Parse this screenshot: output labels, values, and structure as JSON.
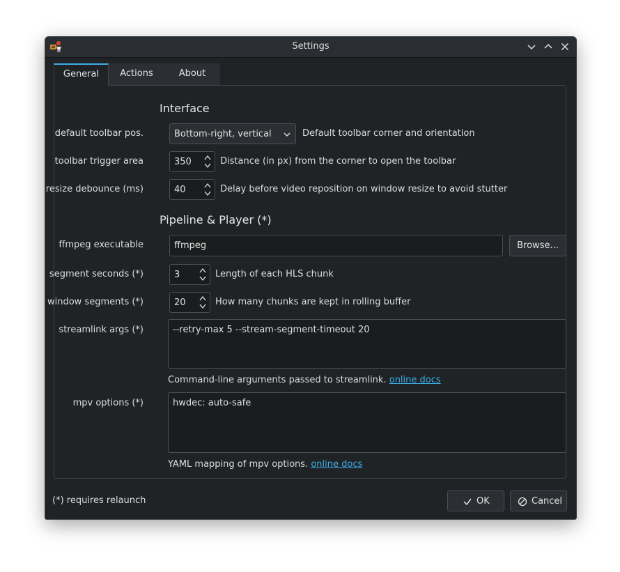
{
  "window": {
    "title": "Settings"
  },
  "tabs": [
    {
      "label": "General"
    },
    {
      "label": "Actions"
    },
    {
      "label": "About"
    }
  ],
  "interface": {
    "title": "Interface",
    "toolbar_pos": {
      "label": "default toolbar pos.",
      "value": "Bottom-right, vertical",
      "description": "Default toolbar corner and orientation"
    },
    "trigger_area": {
      "label": "toolbar trigger area",
      "value": "350",
      "description": "Distance (in px) from the corner to open the toolbar"
    },
    "resize_debounce": {
      "label": "resize debounce (ms)",
      "value": "40",
      "description": "Delay before video reposition on window resize to avoid stutter"
    }
  },
  "pipeline": {
    "title": "Pipeline & Player (*)",
    "ffmpeg": {
      "label": "ffmpeg executable",
      "value": "ffmpeg",
      "browse_label": "Browse..."
    },
    "segment_seconds": {
      "label": "segment seconds (*)",
      "value": "3",
      "description": "Length of each HLS chunk"
    },
    "window_segments": {
      "label": "window segments (*)",
      "value": "20",
      "description": "How many chunks are kept in rolling buffer"
    },
    "streamlink_args": {
      "label": "streamlink args (*)",
      "value": "--retry-max 5 --stream-segment-timeout 20",
      "help": "Command-line arguments passed to streamlink.",
      "link": "online docs"
    },
    "mpv_options": {
      "label": "mpv options (*)",
      "value": "hwdec: auto-safe",
      "help": "YAML mapping of mpv options.",
      "link": "online docs"
    }
  },
  "footer": {
    "note": "(*) requires relaunch",
    "ok_label": "OK",
    "cancel_label": "Cancel"
  }
}
